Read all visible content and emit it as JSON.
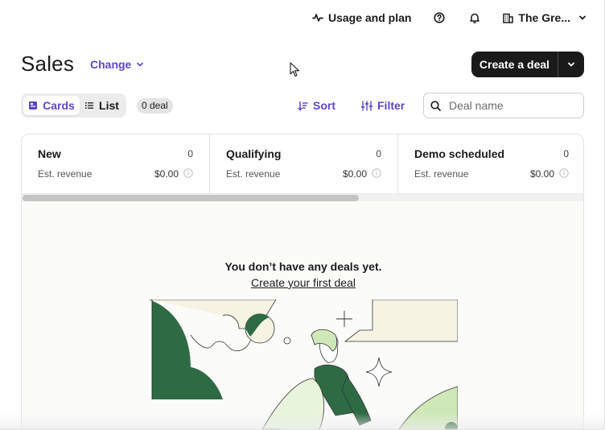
{
  "topbar": {
    "usage_label": "Usage and plan",
    "org_name": "The Gre..."
  },
  "page": {
    "title": "Sales",
    "change_label": "Change",
    "create_label": "Create a deal"
  },
  "controls": {
    "cards_label": "Cards",
    "list_label": "List",
    "deal_count": "0 deal",
    "sort_label": "Sort",
    "filter_label": "Filter",
    "search_placeholder": "Deal name",
    "active_view": "Cards"
  },
  "columns": [
    {
      "name": "New",
      "count": "0",
      "revenue_label": "Est. revenue",
      "revenue": "$0.00"
    },
    {
      "name": "Qualifying",
      "count": "0",
      "revenue_label": "Est. revenue",
      "revenue": "$0.00"
    },
    {
      "name": "Demo scheduled",
      "count": "0",
      "revenue_label": "Est. revenue",
      "revenue": "$0.00"
    }
  ],
  "empty_state": {
    "title": "You don’t have any deals yet.",
    "link": "Create your first deal"
  },
  "colors": {
    "accent": "#5b48c9",
    "primary_button": "#1a1a1a",
    "illustration_dark_green": "#2e6b45",
    "illustration_light_green": "#cfe8b8",
    "illustration_cream": "#f6f3e3"
  },
  "icons": {
    "usage": "activity-pulse-icon",
    "help": "help-circle-icon",
    "notifications": "bell-icon",
    "org": "building-icon",
    "search": "search-icon",
    "sort": "sort-icon",
    "filter": "sliders-icon",
    "cards": "cards-view-icon",
    "list": "list-view-icon",
    "info": "info-icon"
  }
}
